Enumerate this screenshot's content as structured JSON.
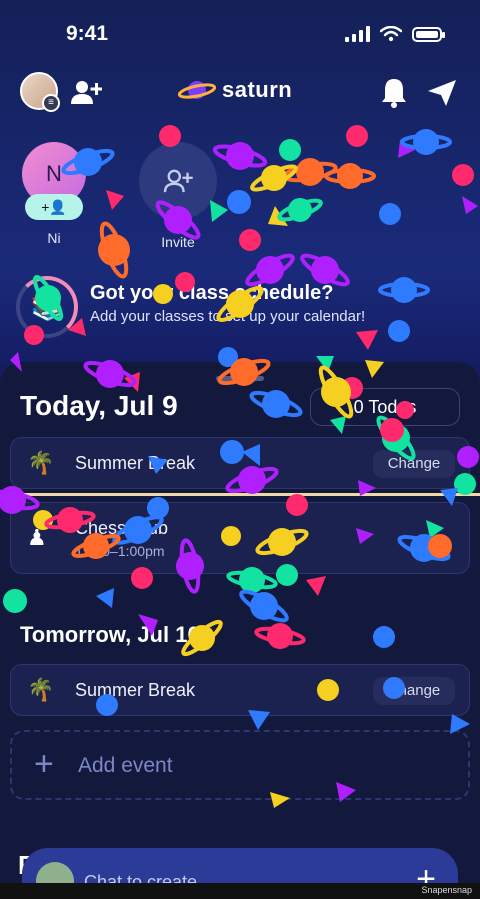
{
  "status": {
    "time": "9:41"
  },
  "app": {
    "name": "saturn"
  },
  "friends": [
    {
      "initial": "N",
      "name": "Ni"
    },
    {
      "name": "Invite"
    }
  ],
  "class_banner": {
    "title": "Got your class schedule?",
    "subtitle": "Add your classes to set up your calendar!"
  },
  "today": {
    "title": "Today, Jul 9",
    "todos": "0 Todos",
    "events": [
      {
        "emoji": "🌴",
        "name": "Summer Break",
        "action": "Change"
      },
      {
        "emoji": "♟",
        "name": "Chess Club",
        "time": "12:00–1:00pm"
      }
    ]
  },
  "tomorrow": {
    "title": "Tomorrow, Jul 10",
    "events": [
      {
        "emoji": "🌴",
        "name": "Summer Break",
        "action": "Change"
      }
    ]
  },
  "add_event": {
    "label": "Add event"
  },
  "chat": {
    "label": "Chat to create"
  },
  "watermark": "Snapensnap",
  "colors": {
    "accent_teal": "#b6f3e9",
    "accent_pink": "#f28bd1",
    "background": "#10163f",
    "confetti": [
      "#f5d020",
      "#ff2a6d",
      "#12e3a0",
      "#2f7bff",
      "#b020ff",
      "#ff6b2a"
    ]
  }
}
